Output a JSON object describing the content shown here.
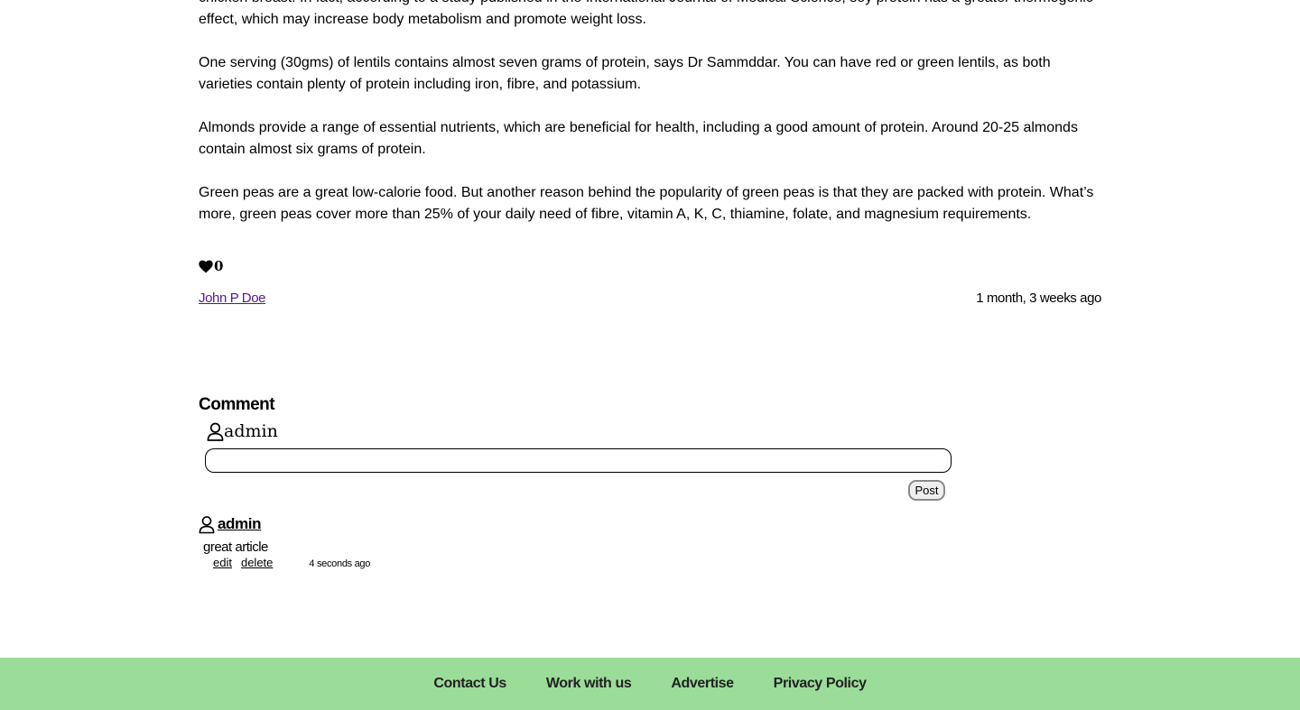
{
  "article": {
    "paragraphs": [
      "chicken breast. In fact, according to a study published in the International Journal of Medical Science, soy protein has a greater thermogenic effect, which may increase body metabolism and promote weight loss.",
      "One serving (30gms) of lentils contains almost seven grams of protein, says Dr Sammddar. You can have red or green lentils, as both varieties contain plenty of protein including iron, fibre, and potassium.",
      "Almonds provide a range of essential nutrients, which are beneficial for health, including a good amount of protein. Around 20-25 almonds contain almost six grams of protein.",
      "Green peas are a great low-calorie food. But another reason behind the popularity of green peas is that they are packed with protein. What’s more, green peas cover more than 25% of your daily need of fibre, vitamin A, K, C, thiamine, folate, and magnesium requirements."
    ],
    "like_icon": "heart-icon",
    "like_count": "0",
    "author": "John P Doe",
    "posted": "1 month, 3 weeks ago"
  },
  "comments_section": {
    "heading": "Comment",
    "user_icon": "user-icon",
    "current_user": "admin",
    "input_value": "",
    "post_label": "Post",
    "items": [
      {
        "author": "admin",
        "text": "great article",
        "edit_label": "edit",
        "delete_label": "delete",
        "time": "4 seconds ago"
      }
    ]
  },
  "footer": {
    "background": "#9bdc98",
    "links": [
      "Contact Us",
      "Work with us",
      "Advertise",
      "Privacy Policy"
    ]
  },
  "colors": {
    "visited_link": "#551a8b"
  }
}
